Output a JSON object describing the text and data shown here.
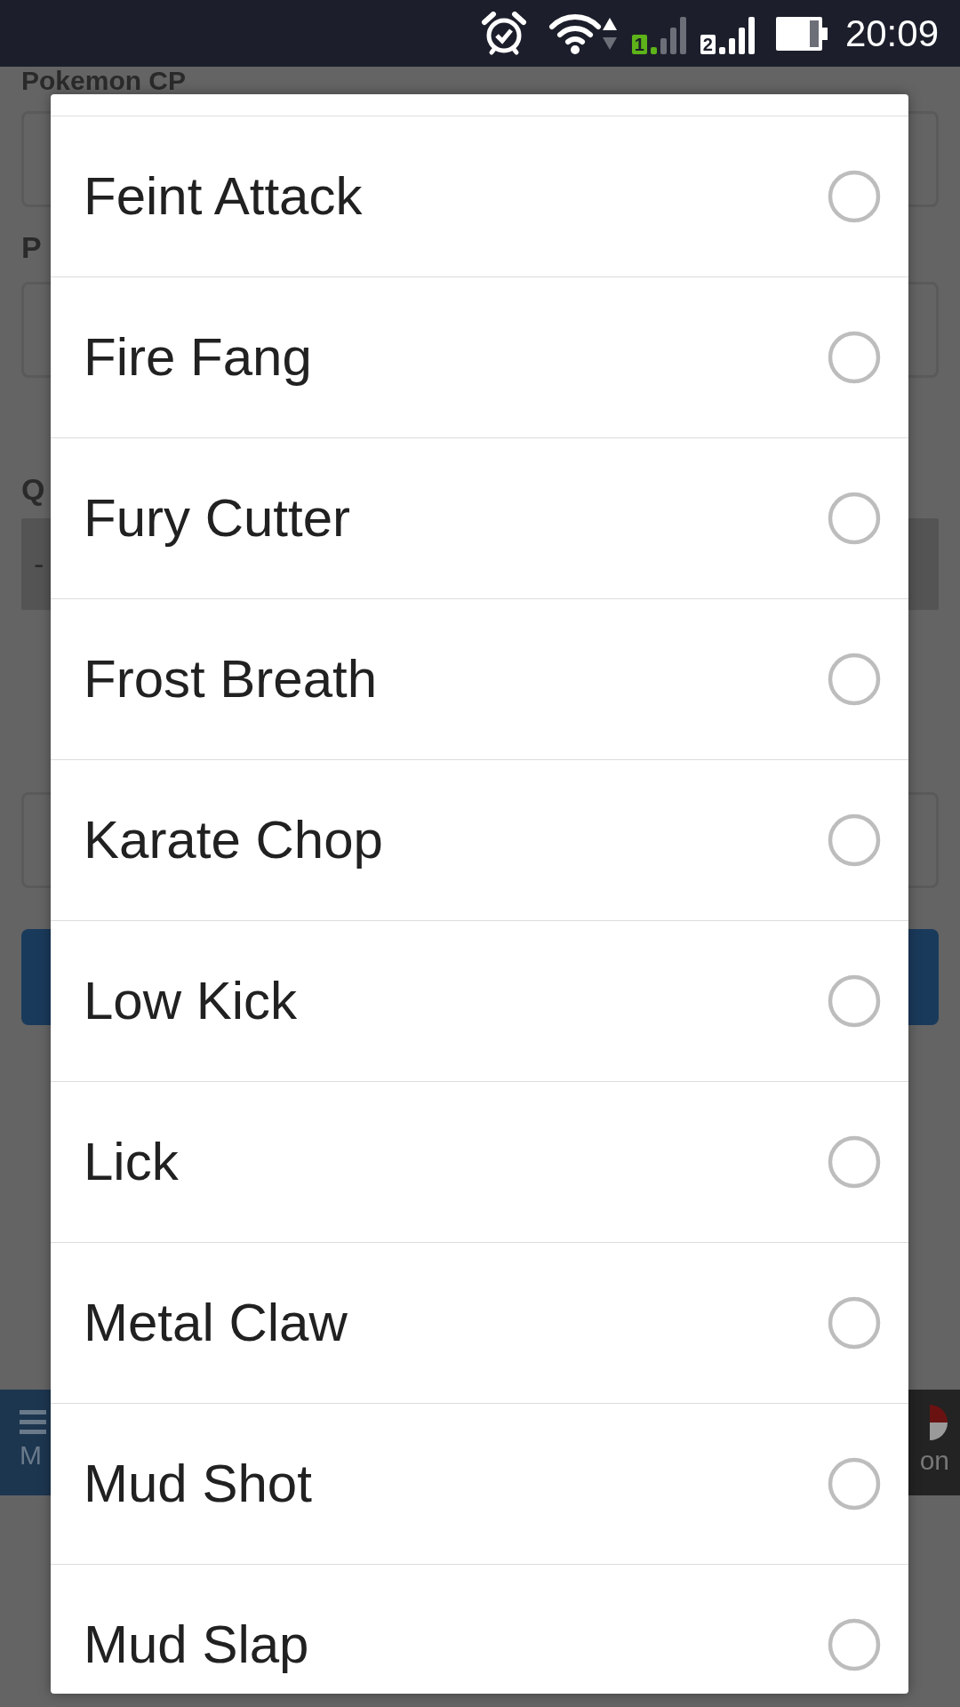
{
  "status_bar": {
    "sim_1": "1",
    "sim_2": "2",
    "time": "20:09"
  },
  "background_page": {
    "label_1": "Pokemon CP",
    "label_2": "P",
    "label_3": "Q",
    "field_3_value": "-",
    "nav_left": "M",
    "nav_right": "on"
  },
  "dialog": {
    "options": [
      {
        "label": "Feint Attack",
        "selected": false
      },
      {
        "label": "Fire Fang",
        "selected": false
      },
      {
        "label": "Fury Cutter",
        "selected": false
      },
      {
        "label": "Frost Breath",
        "selected": false
      },
      {
        "label": "Karate Chop",
        "selected": false
      },
      {
        "label": "Low Kick",
        "selected": false
      },
      {
        "label": "Lick",
        "selected": false
      },
      {
        "label": "Metal Claw",
        "selected": false
      },
      {
        "label": "Mud Shot",
        "selected": false
      },
      {
        "label": "Mud Slap",
        "selected": false
      }
    ]
  }
}
